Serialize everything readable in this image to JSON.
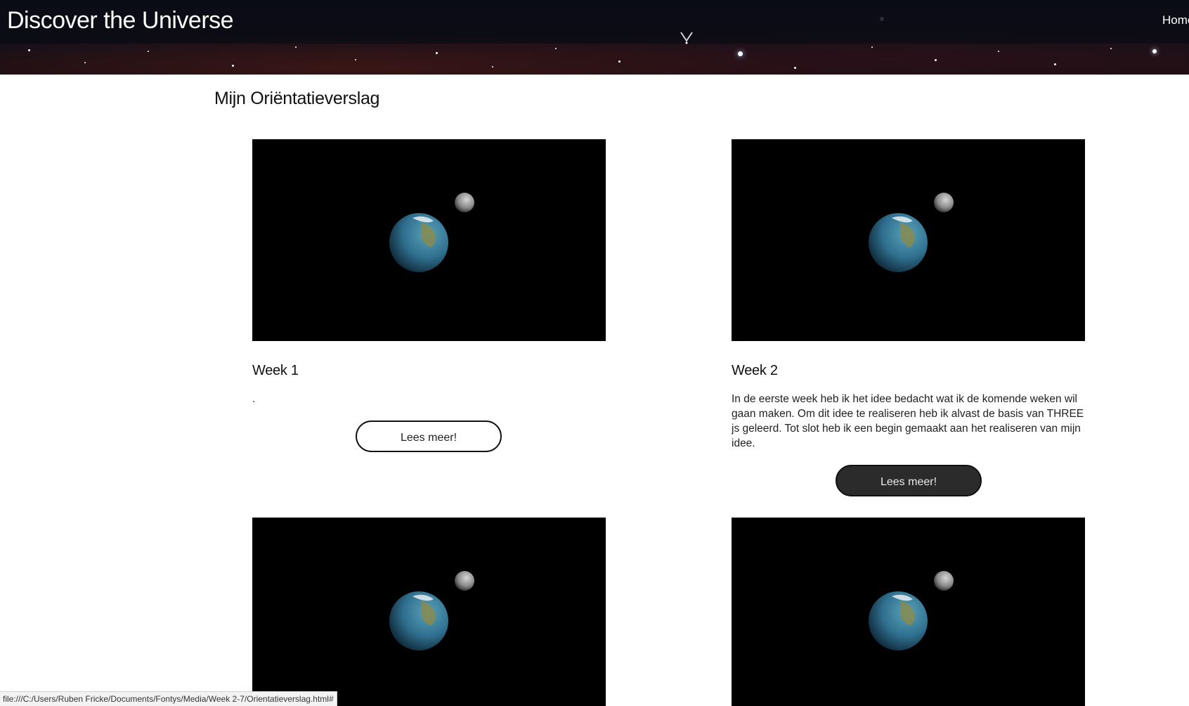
{
  "header": {
    "brand": "Discover the Universe",
    "nav_home": "Home"
  },
  "main": {
    "title": "Mijn Oriëntatieverslag",
    "cards": [
      {
        "title": "Week 1",
        "text": ".",
        "button": "Lees meer!"
      },
      {
        "title": "Week 2",
        "text": "In de eerste week heb ik het idee bedacht wat ik de komende weken wil gaan maken. Om dit idee te realiseren heb ik alvast de basis van THREE js geleerd. Tot slot heb ik een begin gemaakt aan het realiseren van mijn idee.",
        "button": "Lees meer!"
      }
    ]
  },
  "status_bar": {
    "url": "file:///C:/Users/Ruben Fricke/Documents/Fontys/Media/Week 2-7/Orientatieverslag.html#"
  },
  "colors": {
    "card_image_bg": "#000000",
    "button_dark_bg": "#2b2b2b",
    "earth_ocean": "#2f6f8f",
    "earth_land": "#8b8a4a",
    "moon": "#9a9a9a"
  }
}
